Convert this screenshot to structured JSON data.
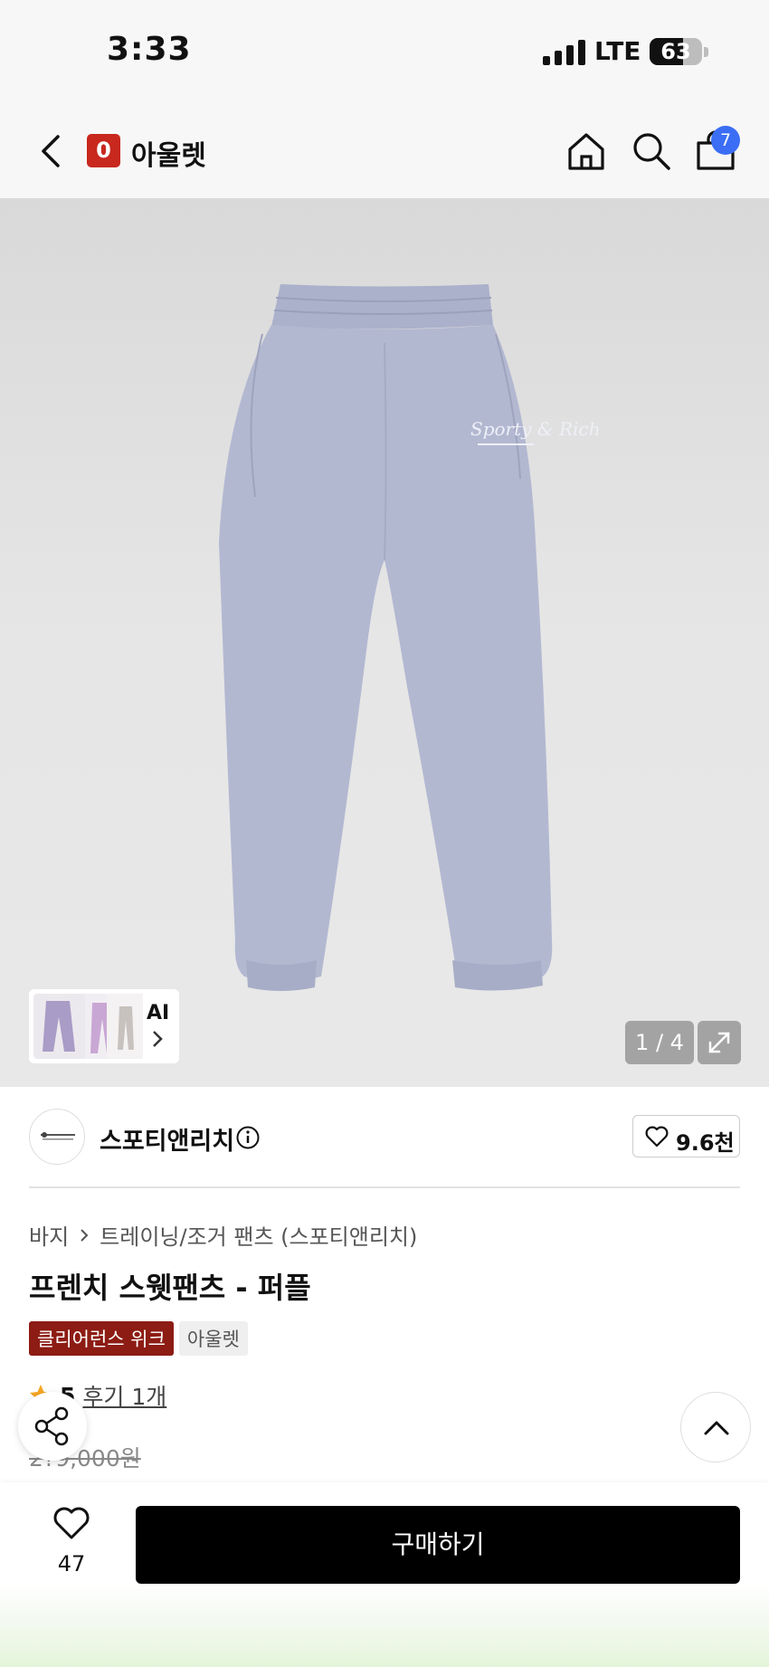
{
  "status_bar": {
    "time": "3:33",
    "network": "LTE",
    "battery": "63",
    "battery_level": 0.63
  },
  "nav": {
    "logo_letter": "0",
    "brand": "아울렛",
    "cart_count": "7"
  },
  "gallery": {
    "ai_label": "AI",
    "pager": "1 / 4"
  },
  "brand_row": {
    "name": "스포티앤리치",
    "likes": "9.6천"
  },
  "product": {
    "breadcrumb": [
      "바지",
      "트레이닝/조거 팬츠 (스포티앤리치)"
    ],
    "title": "프렌치 스웻팬츠 - 퍼플",
    "tags": [
      "클리어런스 위크",
      "아울렛"
    ],
    "rating": "5",
    "reviews": "후기 1개",
    "original_price": "2?9,000원"
  },
  "bottom_bar": {
    "wish_count": "47",
    "buy_label": "구매하기"
  },
  "colors": {
    "accent_red": "#c8281e",
    "tag_red": "#8c1c14",
    "badge_blue": "#3b6ef5",
    "pants": "#b3b8d1"
  }
}
